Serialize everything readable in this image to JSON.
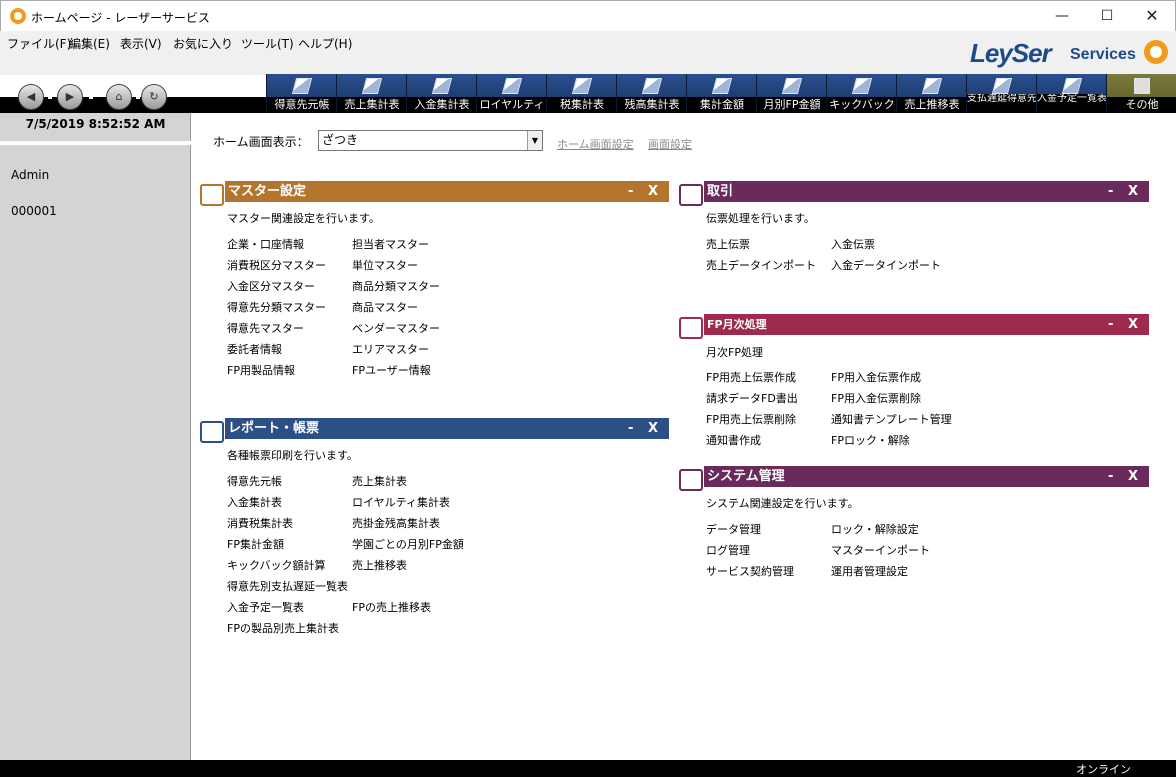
{
  "window": {
    "title": "ホームページ - レーザーサービス",
    "minimize": "—",
    "maximize": "☐",
    "close": "✕"
  },
  "menu": [
    "ファイル(F)",
    "編集(E)",
    "表示(V)",
    "お気に入り",
    "ツール(T)",
    "ヘルプ(H)"
  ],
  "logo": {
    "main": "LeySer",
    "sub": "Services"
  },
  "nav": {
    "back": "◀",
    "forward": "▶",
    "home": "⌂",
    "refresh": "↻"
  },
  "toolbar": [
    "得意先元帳",
    "売上集計表",
    "入金集計表",
    "ロイヤルティ",
    "税集計表",
    "残高集計表",
    "集計金額",
    "月別FP金額",
    "キックバック",
    "売上推移表",
    "支払遅延得意先一覧",
    "入金予定一覧表",
    "その他"
  ],
  "sidebar": {
    "datetime": "7/5/2019 8:52:52 AM",
    "user": "Admin",
    "code": "000001"
  },
  "home": {
    "label": "ホーム画面表示：",
    "select_value": "ざつき",
    "select_arrow": "▼",
    "link_home_settings": "ホーム画面設定",
    "link_screen_settings": "画面設定"
  },
  "panels": {
    "master": {
      "title": "マスター設定",
      "controls": "- X",
      "desc": "マスター関連設定を行います。",
      "col1": [
        "企業・口座情報",
        "消費税区分マスター",
        "入金区分マスター",
        "得意先分類マスター",
        "得意先マスター",
        "委託者情報",
        "FP用製品情報"
      ],
      "col2": [
        "担当者マスター",
        "単位マスター",
        "商品分類マスター",
        "商品マスター",
        "ベンダーマスター",
        "エリアマスター",
        "FPユーザー情報"
      ]
    },
    "trade": {
      "title": "取引",
      "controls": "- X",
      "desc": "伝票処理を行います。",
      "col1": [
        "売上伝票",
        "売上データインポート"
      ],
      "col2": [
        "入金伝票",
        "入金データインポート"
      ]
    },
    "fp": {
      "title": "FP月次処理",
      "controls": "- X",
      "desc": "月次FP処理",
      "col1": [
        "FP用売上伝票作成",
        "請求データFD書出",
        "FP用売上伝票削除",
        "通知書作成"
      ],
      "col2": [
        "FP用入金伝票作成",
        "FP用入金伝票削除",
        "通知書テンプレート管理",
        "FPロック・解除"
      ]
    },
    "report": {
      "title": "レポート・帳票",
      "controls": "- X",
      "desc": "各種帳票印刷を行います。",
      "col1": [
        "得意先元帳",
        "入金集計表",
        "消費税集計表",
        "FP集計金額",
        "キックバック額計算",
        "得意先別支払遅延一覧表",
        "入金予定一覧表",
        "FPの製品別売上集計表"
      ],
      "col2": [
        "売上集計表",
        "ロイヤルティ集計表",
        "売掛金残高集計表",
        "学園ごとの月別FP金額",
        "売上推移表",
        "",
        "FPの売上推移表",
        ""
      ]
    },
    "system": {
      "title": "システム管理",
      "controls": "- X",
      "desc": "システム関連設定を行います。",
      "col1": [
        "データ管理",
        "ログ管理",
        "サービス契約管理"
      ],
      "col2": [
        "ロック・解除設定",
        "マスターインポート",
        "運用者管理設定"
      ]
    }
  },
  "status": {
    "online": "オンライン"
  }
}
